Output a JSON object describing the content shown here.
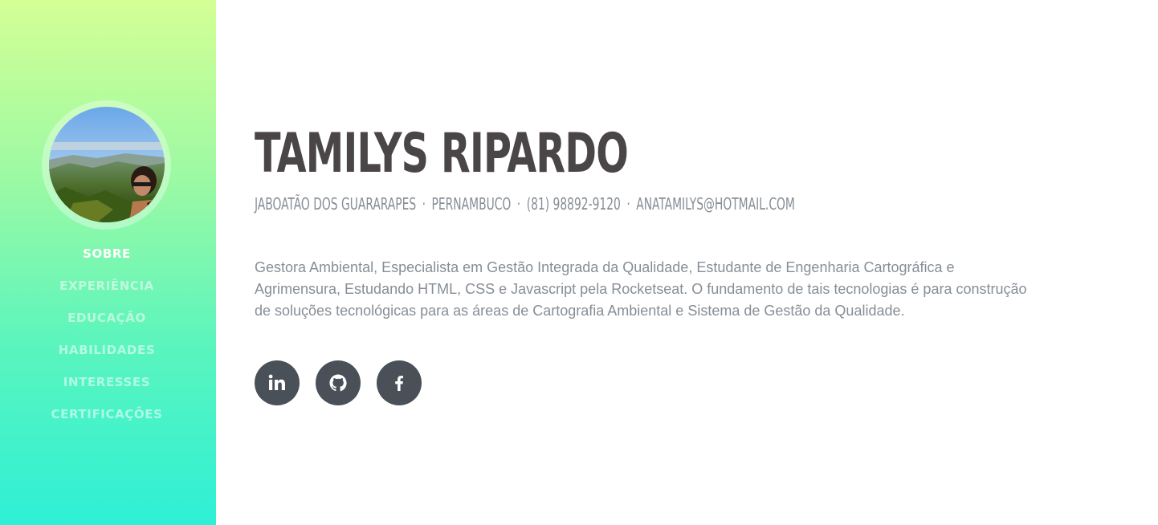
{
  "sidebar": {
    "profile_image_alt": "Tamilys Ripardo",
    "nav": [
      {
        "label": "SOBRE",
        "active": true
      },
      {
        "label": "EXPERIÊNCIA",
        "active": false
      },
      {
        "label": "EDUCAÇÃO",
        "active": false
      },
      {
        "label": "HABILIDADES",
        "active": false
      },
      {
        "label": "INTERESSES",
        "active": false
      },
      {
        "label": "CERTIFICAÇÕES",
        "active": false
      }
    ],
    "gradient_colors": [
      "#d4ff95",
      "#2ef0d6"
    ]
  },
  "main": {
    "name": "TAMILYS RIPARDO",
    "contact": {
      "city": "JABOATÃO DOS GUARARAPES",
      "state": "PERNAMBUCO",
      "phone": "(81) 98892-9120",
      "email": "ANATAMILYS@HOTMAIL.COM",
      "separator": "·"
    },
    "about": "Gestora Ambiental, Especialista em Gestão Integrada da Qualidade, Estudante de Engenharia Cartográfica e Agrimensura, Estudando HTML, CSS e Javascript pela Rocketseat. O fundamento de tais tecnologias é para construção de soluções tecnológicas para as áreas de Cartografia Ambiental e Sistema de Gestão da Qualidade.",
    "social": [
      {
        "icon": "linkedin-icon"
      },
      {
        "icon": "github-icon"
      },
      {
        "icon": "facebook-icon"
      }
    ]
  },
  "colors": {
    "heading": "#4a4546",
    "muted_text": "#868e96",
    "social_bg": "#495057"
  }
}
